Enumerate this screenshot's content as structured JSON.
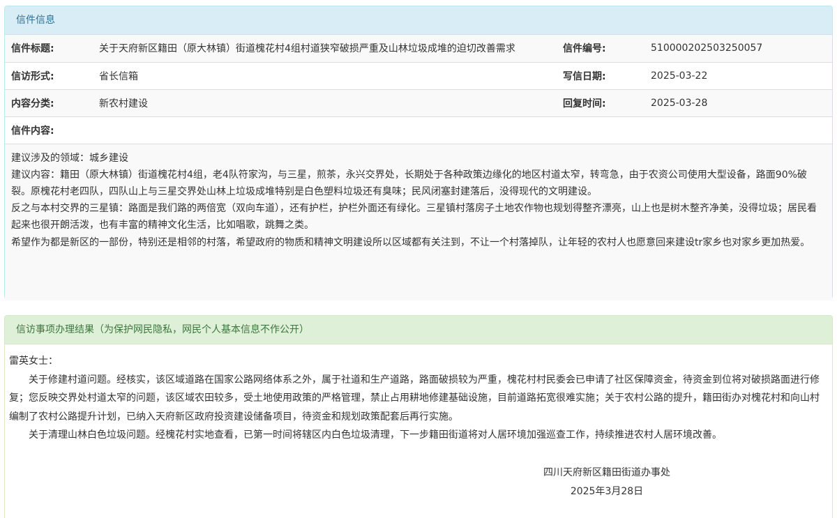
{
  "letter_panel": {
    "heading": "信件信息",
    "rows": [
      {
        "label1": "信件标题:",
        "value1": "关于天府新区籍田（原大林镇）街道槐花村4组村道狭窄破损严重及山林垃圾成堆的迫切改善需求",
        "label2": "信件编号:",
        "value2": "510000202503250057"
      },
      {
        "label1": "信访形式:",
        "value1": "省长信箱",
        "label2": "写信日期:",
        "value2": "2025-03-22"
      },
      {
        "label1": "内容分类:",
        "value1": "新农村建设",
        "label2": "回复时间:",
        "value2": "2025-03-28"
      }
    ],
    "content_label": "信件内容:",
    "content_paragraphs": [
      "建议涉及的领域：城乡建设",
      "建议内容：籍田（原大林镇）街道槐花村4组，老4队符家沟，与三星，煎茶，永兴交界处，长期处于各种政策边缘化的地区村道太窄，转弯急，由于农资公司使用大型设备，路面90%破裂。原槐花村老四队，四队山上与三星交界处山林上垃圾成堆特别是白色塑料垃圾还有臭味；民风闭塞封建落后，没得现代的文明建设。",
      "反之与本村交界的三星镇：路面是我们路的两倍宽（双向车道），还有护栏，护栏外面还有绿化。三星镇村落房子土地农作物也规划得整齐漂亮，山上也是树木整齐净美，没得垃圾；居民看起来也很开朗活泼，也有丰富的精神文化生活，比如唱歌，跳舞之类。",
      "希望作为都是新区的一部份，特别还是相邻的村落，希望政府的物质和精神文明建设所以区域都有关注到，不让一个村落掉队，让年轻的农村人也愿意回来建设tr家乡也对家乡更加热爱。"
    ]
  },
  "result_panel": {
    "heading": "信访事项办理结果（为保护网民隐私，网民个人基本信息不作公开）",
    "salutation": "雷英女士：",
    "paragraphs": [
      "关于修建村道问题。经核实，该区域道路在国家公路网络体系之外，属于社道和生产道路，路面破损较为严重，槐花村村民委会已申请了社区保障资金，待资金到位将对破损路面进行修复；您反映交界处村道太窄的问题，该区域农田较多，受土地使用政策的严格管理，禁止占用耕地修建基础设施，目前道路拓宽很难实施；关于农村公路的提升，籍田街办对槐花村和向山村编制了农村公路提升计划，已纳入天府新区政府投资建设储备项目，待资金和规划政策配套后再行实施。",
      "关于清理山林白色垃圾问题。经槐花村实地查看，已第一时间将辖区内白色垃圾清理，下一步籍田街道将对人居环境加强巡查工作，持续推进农村人居环境改善。"
    ],
    "signature": "四川天府新区籍田街道办事处",
    "date": "2025年3月28日"
  }
}
